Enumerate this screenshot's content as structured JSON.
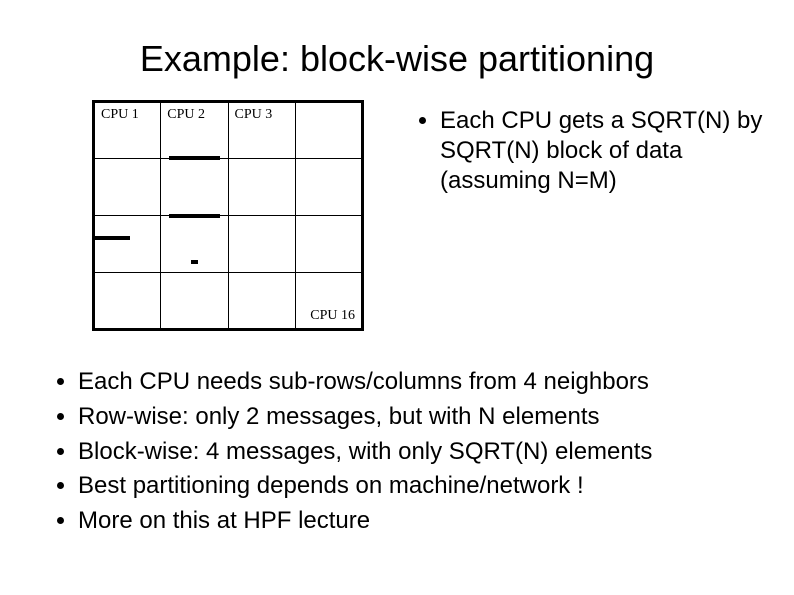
{
  "title": "Example: block-wise partitioning",
  "grid": {
    "cpu1": "CPU 1",
    "cpu2": "CPU 2",
    "cpu3": "CPU 3",
    "cpu16": "CPU 16"
  },
  "right_bullet": "Each CPU gets a SQRT(N) by SQRT(N) block of data (assuming N=M)",
  "bullets": [
    "Each CPU needs sub-rows/columns from 4 neighbors",
    "Row-wise: only 2 messages, but with N elements",
    "Block-wise: 4 messages, with only SQRT(N) elements",
    "Best partitioning depends on machine/network !",
    "More on this at HPF lecture"
  ]
}
